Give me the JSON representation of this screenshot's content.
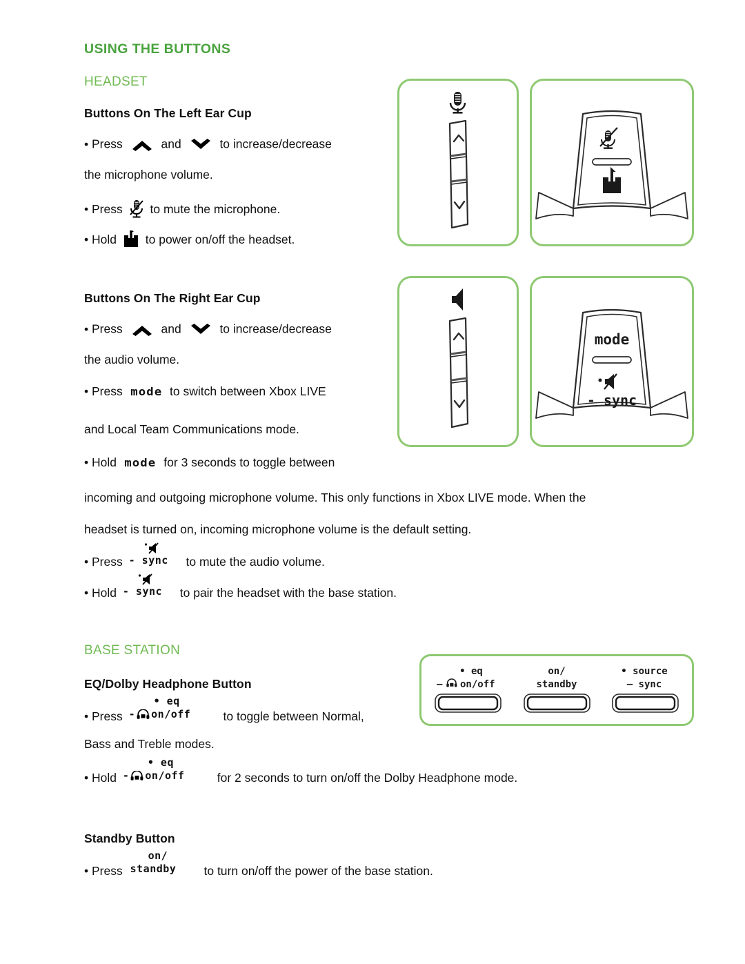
{
  "colors": {
    "heading_primary": "#4aa33f",
    "heading_secondary": "#6fba52",
    "panel_border": "#8ec972",
    "body_text": "#111111"
  },
  "headings": {
    "title": "USING THE BUTTONS",
    "headset": "HEADSET",
    "base_station": "BASE STATION"
  },
  "sections": {
    "left_ear_cup": {
      "title": "Buttons On The Left Ear Cup",
      "lines": [
        {
          "pre": "Press",
          "mid": "and",
          "post": "to increase/decrease",
          "cont": "the microphone volume."
        },
        {
          "pre": "Press",
          "post": "to mute the microphone."
        },
        {
          "pre": "Hold",
          "post": "to power on/off the headset."
        }
      ]
    },
    "right_ear_cup": {
      "title": "Buttons On The Right Ear Cup",
      "lines": [
        {
          "pre": "Press",
          "mid": "and",
          "post": "to increase/decrease",
          "cont": "the audio volume."
        },
        {
          "pre": "Press",
          "glyph": "mode",
          "post": "to switch between Xbox LIVE",
          "cont": "and Local Team Communications mode."
        },
        {
          "pre": "Hold",
          "glyph": "mode",
          "post": "for 3 seconds to toggle between"
        }
      ],
      "paragraph": [
        "incoming and outgoing microphone volume. This only functions in Xbox LIVE mode. When the",
        "headset is turned on, incoming microphone volume is the default setting."
      ],
      "sync_lines": [
        {
          "pre": "Press",
          "post": "to mute the audio volume."
        },
        {
          "pre": "Hold",
          "post": "to pair the headset with the base station."
        }
      ]
    },
    "eq_dolby": {
      "title": "EQ/Dolby Headphone Button",
      "lines": [
        {
          "pre": "Press",
          "post": "to toggle between Normal,",
          "cont": "Bass and Treble modes."
        },
        {
          "pre": "Hold",
          "post": "for 2 seconds to turn on/off the Dolby Headphone mode."
        }
      ]
    },
    "standby": {
      "title": "Standby Button",
      "lines": [
        {
          "pre": "Press",
          "post": "to turn on/off the power of the base station."
        }
      ]
    }
  },
  "glyphs": {
    "mode": "mode",
    "sync_label": "- sync",
    "eq_top": "• eq",
    "eq_bottom_dash": "-",
    "eq_bottom_label": "on/off",
    "standby_top": "on/",
    "standby_bottom": "standby"
  },
  "diagrams": {
    "left_side_view": {
      "label": "left-ear-cup-side-view",
      "icon": "microphone"
    },
    "left_front_view": {
      "label": "left-ear-cup-front-view",
      "icons": [
        "microphone-mute",
        "power"
      ]
    },
    "right_side_view": {
      "label": "right-ear-cup-side-view",
      "icon": "speaker"
    },
    "right_front_view": {
      "label": "right-ear-cup-front-view",
      "texts": [
        "mode",
        "- sync"
      ]
    },
    "base_station_panel": {
      "buttons": [
        {
          "top": "• eq",
          "bottom": "- on/off",
          "has_headphone_icon": true
        },
        {
          "top": "on/",
          "bottom": "standby",
          "has_headphone_icon": false
        },
        {
          "top": "• source",
          "bottom": "- sync",
          "has_headphone_icon": false
        }
      ]
    }
  }
}
